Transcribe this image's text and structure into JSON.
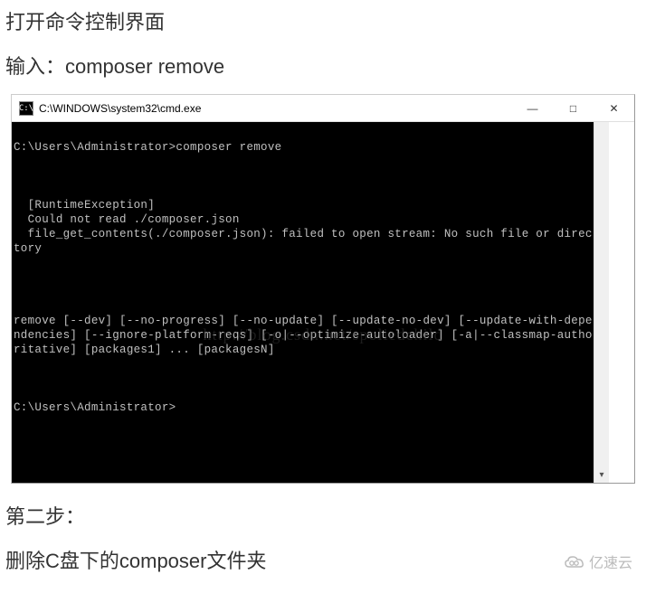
{
  "heading1": "打开命令控制界面",
  "heading2": "输入：composer remove",
  "window": {
    "title": "C:\\WINDOWS\\system32\\cmd.exe",
    "icon_text": "C:\\",
    "minimize": "—",
    "maximize": "□",
    "close": "✕"
  },
  "terminal_text": "\nC:\\Users\\Administrator>composer remove\n\n\n\n  [RuntimeException]\n  Could not read ./composer.json\n  file_get_contents(./composer.json): failed to open stream: No such file or directory\n\n\n\n\nremove [--dev] [--no-progress] [--no-update] [--update-no-dev] [--update-with-dependencies] [--ignore-platform-reqs] [-o|--optimize-autoloader] [-a|--classmap-authoritative] [packages1] ... [packagesN]\n\n\n\nC:\\Users\\Administrator>",
  "watermark_blog": "http://blog.csdn.net/spoliedchild",
  "heading3": "第二步：",
  "heading4": "删除C盘下的composer文件夹",
  "watermark_cloud": "亿速云",
  "scroll_down": "▾"
}
